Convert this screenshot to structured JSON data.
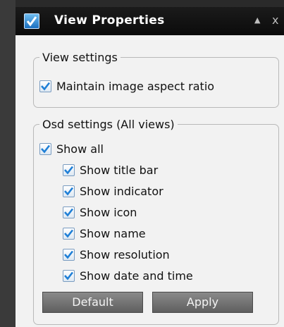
{
  "window": {
    "title": "View Properties",
    "icon": "checkbox-icon",
    "collapse_glyph": "▲",
    "close_glyph": "x"
  },
  "view_settings": {
    "legend": "View settings",
    "maintain_aspect": {
      "label": "Maintain image aspect ratio",
      "checked": true
    }
  },
  "osd_settings": {
    "legend": "Osd settings (All views)",
    "show_all": {
      "label": "Show all",
      "checked": true
    },
    "items": [
      {
        "label": "Show title bar",
        "checked": true
      },
      {
        "label": "Show indicator",
        "checked": true
      },
      {
        "label": "Show icon",
        "checked": true
      },
      {
        "label": "Show name",
        "checked": true
      },
      {
        "label": "Show resolution",
        "checked": true
      },
      {
        "label": "Show date and time",
        "checked": true
      }
    ]
  },
  "buttons": {
    "default_label": "Default",
    "apply_label": "Apply"
  },
  "colors": {
    "checkmark": "#1f7fd6",
    "titlebar": "#111111",
    "button": "#6f6f6f"
  }
}
